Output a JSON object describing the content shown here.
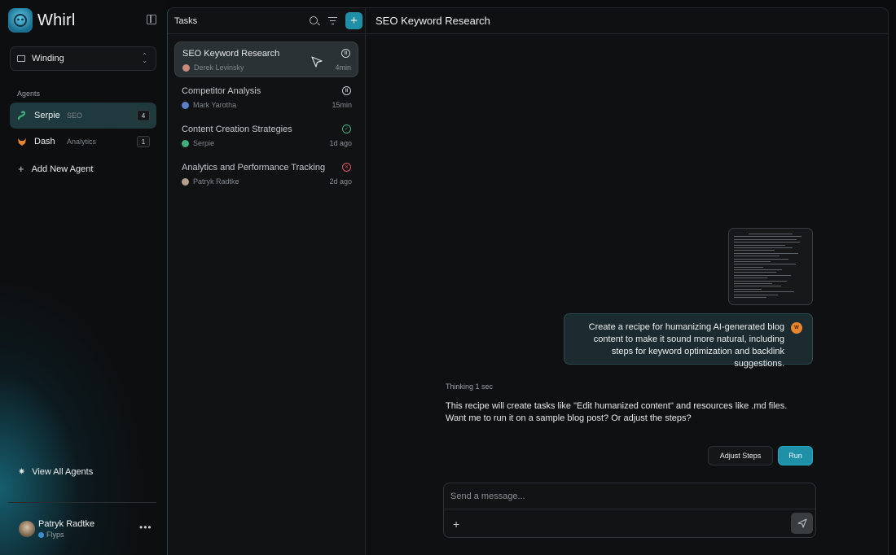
{
  "brand": {
    "name": "Whirl"
  },
  "workspace": {
    "label": "Winding"
  },
  "agents": {
    "heading": "Agents",
    "items": [
      {
        "name": "Serpie",
        "tag": "SEO",
        "count": "4",
        "avatar": "snake-icon"
      },
      {
        "name": "Dash",
        "tag": "Analytics",
        "count": "1",
        "avatar": "fox-icon"
      }
    ],
    "add_label": "Add New Agent"
  },
  "view_all": "View All Agents",
  "user": {
    "name": "Patryk Radtke",
    "org": "Flyps"
  },
  "tasks": {
    "title": "Tasks",
    "items": [
      {
        "title": "SEO Keyword Research",
        "assignee": "Derek Levinsky",
        "time": "4min",
        "status": "paused",
        "active": true
      },
      {
        "title": "Competitor Analysis",
        "assignee": "Mark Yarotha",
        "time": "15min",
        "status": "paused"
      },
      {
        "title": "Content Creation Strategies",
        "assignee": "Serpie",
        "time": "1d ago",
        "status": "done"
      },
      {
        "title": "Analytics and Performance Tracking",
        "assignee": "Patryk Radtke",
        "time": "2d ago",
        "status": "failed"
      }
    ]
  },
  "chat": {
    "title": "SEO Keyword Research",
    "user_message": "Create a recipe for humanizing AI-generated blog content to make it sound more natural, including steps for keyword optimization and backlink suggestions.",
    "thinking": "Thinking 1 sec",
    "reply_line1": "This recipe will create tasks like \"Edit humanized content\" and resources like .md files.",
    "reply_line2": "Want me to run it on a sample blog post? Or adjust the steps?",
    "adjust_label": "Adjust Steps",
    "run_label": "Run",
    "composer_placeholder": "Send a message..."
  },
  "colors": {
    "accent": "#1e90a8",
    "success": "#3fb07a",
    "error": "#e05561",
    "background": "#0b0c0d"
  }
}
